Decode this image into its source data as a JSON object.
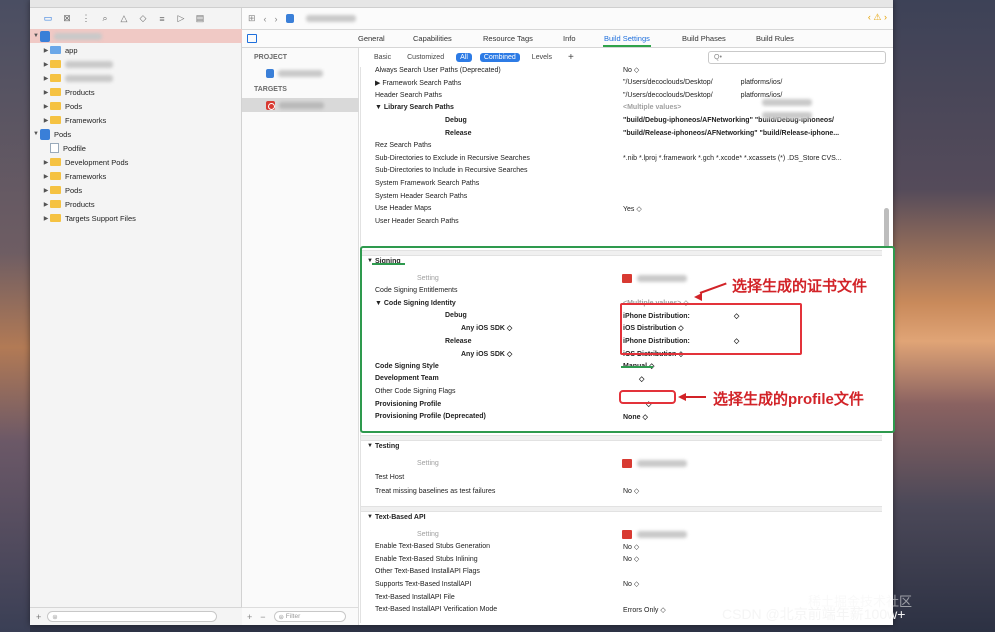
{
  "navigator": {
    "items": [
      {
        "label": "",
        "kind": "project",
        "level": 0
      },
      {
        "label": "app",
        "kind": "folder-blue",
        "level": 1
      },
      {
        "label": "",
        "kind": "folder",
        "level": 1
      },
      {
        "label": "",
        "kind": "folder",
        "level": 1
      },
      {
        "label": "Products",
        "kind": "folder",
        "level": 1
      },
      {
        "label": "Pods",
        "kind": "folder",
        "level": 1
      },
      {
        "label": "Frameworks",
        "kind": "folder",
        "level": 1
      },
      {
        "label": "Pods",
        "kind": "project",
        "level": 0
      },
      {
        "label": "Podfile",
        "kind": "file",
        "level": 1
      },
      {
        "label": "Development Pods",
        "kind": "folder",
        "level": 1
      },
      {
        "label": "Frameworks",
        "kind": "folder",
        "level": 1
      },
      {
        "label": "Pods",
        "kind": "folder",
        "level": 1
      },
      {
        "label": "Products",
        "kind": "folder",
        "level": 1
      },
      {
        "label": "Targets Support Files",
        "kind": "folder",
        "level": 1
      }
    ],
    "footer_plus": "+",
    "filter_icon": "filter-icon"
  },
  "editor_tabs": [
    "General",
    "Capabilities",
    "Resource Tags",
    "Info",
    "Build Settings",
    "Build Phases",
    "Build Rules"
  ],
  "active_tab": "Build Settings",
  "targets": {
    "project_header": "PROJECT",
    "targets_header": "TARGETS",
    "footer_plus": "+",
    "footer_minus": "−",
    "filter_placeholder": "Filter"
  },
  "filterbar": {
    "basic": "Basic",
    "customized": "Customized",
    "all": "All",
    "combined": "Combined",
    "levels": "Levels",
    "plus": "+"
  },
  "search": {
    "placeholder": "Q•"
  },
  "settings": {
    "search_paths": [
      {
        "key": "Always Search User Paths (Deprecated)",
        "value": "No ◇"
      },
      {
        "key": "▶ Framework Search Paths",
        "value": "\"/Users/decoclouds/Desktop/    platforms/ios/"
      },
      {
        "key": "Header Search Paths",
        "value": "\"/Users/decoclouds/Desktop/    platforms/ios/"
      },
      {
        "key": "▼ Library Search Paths",
        "value": "<Multiple values>",
        "bold": true
      },
      {
        "key": "Debug",
        "value": "\"build/Debug-iphoneos/AFNetworking\" \"build/Debug-iphoneos/",
        "bold": true,
        "indent": 1
      },
      {
        "key": "Release",
        "value": "\"build/Release-iphoneos/AFNetworking\" \"build/Release-iphone...",
        "bold": true,
        "indent": 1
      },
      {
        "key": "Rez Search Paths",
        "value": ""
      },
      {
        "key": "Sub-Directories to Exclude in Recursive Searches",
        "value": "*.nib *.lproj *.framework *.gch *.xcode* *.xcassets (*) .DS_Store CVS..."
      },
      {
        "key": "Sub-Directories to Include in Recursive Searches",
        "value": ""
      },
      {
        "key": "System Framework Search Paths",
        "value": ""
      },
      {
        "key": "System Header Search Paths",
        "value": ""
      },
      {
        "key": "Use Header Maps",
        "value": "Yes ◇"
      },
      {
        "key": "User Header Search Paths",
        "value": ""
      }
    ],
    "signing": {
      "title": "Signing",
      "rows": [
        {
          "key": "Setting",
          "value": "",
          "grey": true
        },
        {
          "key": "Code Signing Entitlements",
          "value": ""
        },
        {
          "key": "▼ Code Signing Identity",
          "value": "<Multiple values> ◇",
          "bold": true
        },
        {
          "key": "Debug",
          "value": "iPhone Distribution:       ◇",
          "bold": true,
          "indent": 1
        },
        {
          "key": "Any iOS SDK ◇",
          "value": "iOS Distribution ◇",
          "bold": true,
          "indent": 2
        },
        {
          "key": "Release",
          "value": "iPhone Distribution:       ◇",
          "bold": true,
          "indent": 1
        },
        {
          "key": "Any iOS SDK ◇",
          "value": "iOS Distribution ◇",
          "bold": true,
          "indent": 2
        },
        {
          "key": "Code Signing Style",
          "value": "Manual ◇",
          "bold": true
        },
        {
          "key": "Development Team",
          "value": "   ◇",
          "bold": true
        },
        {
          "key": "Other Code Signing Flags",
          "value": ""
        },
        {
          "key": "Provisioning Profile",
          "value": "    ◇",
          "bold": true
        },
        {
          "key": "Provisioning Profile (Deprecated)",
          "value": "None ◇",
          "bold": true
        }
      ]
    },
    "testing": {
      "title": "Testing",
      "rows": [
        {
          "key": "Setting",
          "value": "",
          "grey": true
        },
        {
          "key": "Test Host",
          "value": ""
        },
        {
          "key": "Treat missing baselines as test failures",
          "value": "No ◇"
        }
      ]
    },
    "text_api": {
      "title": "Text-Based API",
      "rows": [
        {
          "key": "Setting",
          "value": "",
          "grey": true
        },
        {
          "key": "Enable Text-Based Stubs Generation",
          "value": "No ◇"
        },
        {
          "key": "Enable Text-Based Stubs Inlining",
          "value": "No ◇"
        },
        {
          "key": "Other Text-Based InstallAPI Flags",
          "value": ""
        },
        {
          "key": "Supports Text-Based InstallAPI",
          "value": "No ◇"
        },
        {
          "key": "Text-Based InstallAPI File",
          "value": ""
        },
        {
          "key": "Text-Based InstallAPI Verification Mode",
          "value": "Errors Only ◇"
        }
      ]
    }
  },
  "annotations": {
    "cert": "选择生成的证书文件",
    "profile": "选择生成的profile文件"
  },
  "watermark": {
    "main": "CSDN @北京前端年薪100w+",
    "ghost": "稀土掘金技术社区"
  },
  "colors": {
    "accent": "#1e6fdc",
    "green": "#2e9a4e",
    "red": "#d22328"
  }
}
